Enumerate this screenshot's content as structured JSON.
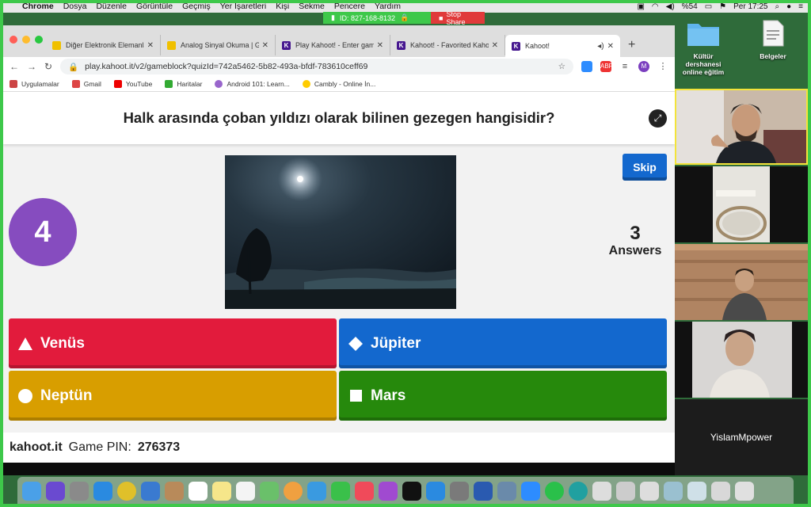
{
  "menubar": {
    "app": "Chrome",
    "items": [
      "Dosya",
      "Düzenle",
      "Görüntüle",
      "Geçmiş",
      "Yer İşaretleri",
      "Kişi",
      "Sekme",
      "Pencere",
      "Yardım"
    ],
    "battery": "%54",
    "clock": "Per 17:25"
  },
  "share": {
    "id_label": "ID: 827-168-8132",
    "stop_label": "Stop Share"
  },
  "browser": {
    "tabs": [
      {
        "title": "Diğer Elektronik Elemanlar",
        "icon": "lightbulb-icon",
        "color": "#f0c000"
      },
      {
        "title": "Analog Sinyal Okuma | Ge",
        "icon": "lightbulb-icon",
        "color": "#f0c000"
      },
      {
        "title": "Play Kahoot! - Enter game",
        "icon": "kahoot-icon",
        "color": "#46178f"
      },
      {
        "title": "Kahoot! - Favorited Kahoo",
        "icon": "kahoot-icon",
        "color": "#46178f"
      },
      {
        "title": "Kahoot!",
        "icon": "kahoot-icon",
        "color": "#46178f"
      }
    ],
    "url": "play.kahoot.it/v2/gameblock?quizId=742a5462-5b82-493a-bfdf-783610ceff69",
    "profile_initial": "M",
    "bookmarks": [
      {
        "label": "Uygulamalar",
        "color": "#c44"
      },
      {
        "label": "Gmail",
        "color": "#d44"
      },
      {
        "label": "YouTube",
        "color": "#e00"
      },
      {
        "label": "Haritalar",
        "color": "#3a3"
      },
      {
        "label": "Android 101: Learn...",
        "color": "#96c"
      },
      {
        "label": "Cambly - Online İn...",
        "color": "#fc0"
      }
    ]
  },
  "kahoot": {
    "question": "Halk arasında çoban yıldızı olarak bilinen gezegen hangisidir?",
    "timer": "4",
    "skip_label": "Skip",
    "answers_count": "3",
    "answers_label": "Answers",
    "options": {
      "red": {
        "label": "Venüs",
        "shape": "triangle-icon"
      },
      "blue": {
        "label": "Jüpiter",
        "shape": "diamond-icon"
      },
      "yellow": {
        "label": "Neptün",
        "shape": "circle-icon"
      },
      "green": {
        "label": "Mars",
        "shape": "square-icon"
      }
    },
    "footer_brand": "kahoot.it",
    "footer_pin_label": "Game PIN:",
    "footer_pin": "276373",
    "colors": {
      "purple": "#864cbf",
      "red": "#e21b3c",
      "blue": "#1368ce",
      "yellow": "#d89e00",
      "green": "#26890c"
    }
  },
  "desktop": {
    "icons": [
      {
        "label": "Kültür dershanesi online eğitim",
        "icon": "folder-icon"
      },
      {
        "label": "Belgeler",
        "icon": "document-icon"
      }
    ]
  },
  "video": {
    "participant_name": "YislamMpower"
  }
}
